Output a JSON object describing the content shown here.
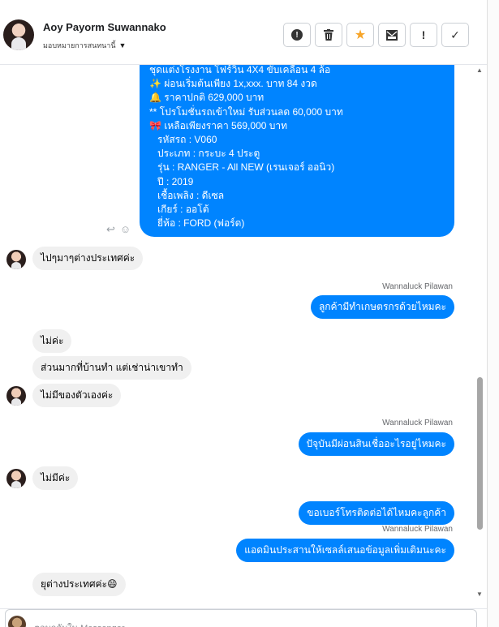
{
  "header": {
    "contact_name": "Aoy Payorm Suwannako",
    "assignment_label": "มอบหมายการสนทนานี้",
    "toolbar": [
      {
        "name": "report-button",
        "icon": "alert-circle-icon",
        "glyph": "❗"
      },
      {
        "name": "delete-button",
        "icon": "trash-icon",
        "glyph": "🗑"
      },
      {
        "name": "star-button",
        "icon": "star-icon",
        "glyph": "★"
      },
      {
        "name": "archive-button",
        "icon": "archive-mail-icon",
        "glyph": "✉"
      },
      {
        "name": "mark-spam-button",
        "icon": "exclamation-icon",
        "glyph": "!"
      },
      {
        "name": "mark-done-button",
        "icon": "check-icon",
        "glyph": "✓"
      }
    ]
  },
  "card": {
    "lines": [
      "ชุดแต่งโรงงาน โฟร์วิน 4X4 ขับเคลื่อน 4 ล้อ",
      "✨  ผ่อนเริ่มต้นเพียง 1x,xxx. บาท 84 งวด",
      "🔔  ราคาปกติ 629,000 บาท",
      "** โปรโมชั่นรถเข้าใหม่ รับส่วนลด 60,000 บาท",
      "🎀  เหลือเพียงราคา 569,000 บาท",
      "รหัสรถ : V060",
      "ประเภท : กระบะ 4 ประตู",
      "รุ่น : RANGER - All NEW (เรนเจอร์ ออนิว)",
      "ปี : 2019",
      "เชื้อเพลิง : ดีเซล",
      "เกียร์ : ออโต้",
      "ยี่ห้อ : FORD (ฟอร์ด)"
    ]
  },
  "messages": {
    "m1": "ไปๆมาๆต่างประเทศค่ะ",
    "sender1": "Wannaluck Pilawan",
    "m2": "ลูกค้ามีทำเกษตรกรด้วยไหมคะ",
    "m3": "ไม่ค่ะ",
    "m4": "ส่วนมากที่บ้านทำ แต่เช่าน่าเขาทำ",
    "m5": "ไม่มีของตัวเองค่ะ",
    "sender2": "Wannaluck Pilawan",
    "m6": "ปัจุบันมีผ่อนสินเชื่ออะไรอยู่ไหมคะ",
    "m7": "ไม่มีค่ะ",
    "m8": "ขอเบอร์โทรติดต่อได้ไหมคะลูกค้า",
    "sender3": "Wannaluck Pilawan",
    "m9": "แอดมินประสานให้เซลล์เสนอข้อมูลเพิ่มเติมนะคะ",
    "m10": "ยุต่างประเทศค่ะ😄"
  },
  "composer": {
    "placeholder": "ตอบกลับใน Messenger"
  },
  "colors": {
    "outgoing": "#0084ff",
    "incoming": "#f0f0f0",
    "star": "#f7a529"
  }
}
